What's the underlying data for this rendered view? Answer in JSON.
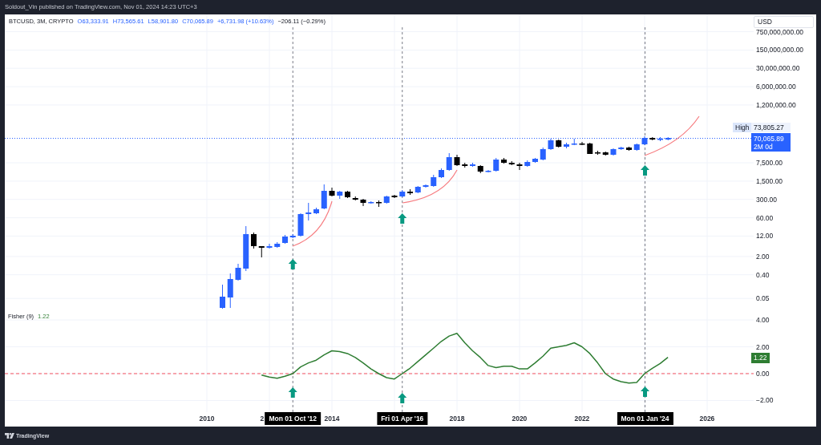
{
  "header": {
    "text": "Soldout_Vin published on TradingView.com, Nov 01, 2024 14:23 UTC+3"
  },
  "legend": {
    "symbol": "BTCUSD, 3M, CRYPTO",
    "ohlc": [
      "O63,333.91",
      "H73,565.61",
      "L58,901.80",
      "C70,065.89"
    ],
    "change": "+6,731.98 (+10.63%)",
    "last_change": "−206.11 (−0.29%)"
  },
  "price_axis": {
    "currency": "USD",
    "ticks": [
      "750,000,000.00",
      "150,000,000.00",
      "30,000,000.00",
      "6,000,000.00",
      "1,200,000.00",
      "7,500.00",
      "1,500.00",
      "300.00",
      "60.00",
      "12.00",
      "2.00",
      "0.40",
      "0.05"
    ]
  },
  "high_marker": {
    "label": "High",
    "value": "73,805.27"
  },
  "last_price": {
    "value": "70,065.89",
    "countdown": "2M 0d"
  },
  "signals": [
    {
      "date": "Mon 01 Oct '12"
    },
    {
      "date": "Fri 01 Apr '16"
    },
    {
      "date": "Mon 01 Jan '24"
    }
  ],
  "time_axis": {
    "covered_tick": "2"
  },
  "indicator": {
    "value": "1.22",
    "axis_value": "1.22",
    "chart_data": {
      "type": "line",
      "x": [
        2011.75,
        2012,
        2012.25,
        2012.5,
        2012.75,
        2013,
        2013.25,
        2013.5,
        2013.75,
        2014,
        2014.25,
        2014.5,
        2014.75,
        2015,
        2015.25,
        2015.5,
        2015.75,
        2016,
        2016.25,
        2016.5,
        2016.75,
        2017,
        2017.25,
        2017.5,
        2017.75,
        2018,
        2018.25,
        2018.5,
        2018.75,
        2019,
        2019.25,
        2019.5,
        2019.75,
        2020,
        2020.25,
        2020.5,
        2020.75,
        2021,
        2021.25,
        2021.5,
        2021.75,
        2022,
        2022.25,
        2022.5,
        2022.75,
        2023,
        2023.25,
        2023.5,
        2023.75,
        2024,
        2024.25,
        2024.5,
        2024.75
      ],
      "series": [
        {
          "name": "Fisher (9)",
          "color": "#2e7d32",
          "values": [
            -0.1,
            -0.25,
            -0.35,
            -0.2,
            0.0,
            0.5,
            0.8,
            1.0,
            1.4,
            1.7,
            1.65,
            1.5,
            1.2,
            0.8,
            0.35,
            0.0,
            -0.3,
            -0.4,
            0.0,
            0.4,
            0.9,
            1.4,
            1.9,
            2.4,
            2.8,
            3.0,
            2.3,
            1.7,
            1.2,
            0.6,
            0.45,
            0.55,
            0.55,
            0.35,
            0.35,
            0.8,
            1.3,
            1.9,
            2.0,
            2.1,
            2.3,
            2.0,
            1.5,
            0.8,
            0.0,
            -0.4,
            -0.6,
            -0.7,
            -0.65,
            0.0,
            0.4,
            0.75,
            1.22
          ]
        }
      ],
      "xlim": [
        2003.54,
        2027.49
      ],
      "ylim": [
        -2.87,
        4.84
      ],
      "xticks": [
        {
          "value": 2010,
          "label": "2010"
        },
        {
          "value": 2014,
          "label": "2014"
        },
        {
          "value": 2018,
          "label": "2018"
        },
        {
          "value": 2020,
          "label": "2020"
        },
        {
          "value": 2022,
          "label": "2022"
        },
        {
          "value": 2026,
          "label": "2026"
        }
      ],
      "yticks": [
        {
          "value": 4,
          "label": "4.00"
        },
        {
          "value": 2,
          "label": "2.00"
        },
        {
          "value": 0,
          "label": "0.00"
        },
        {
          "value": -2,
          "label": "−2.00"
        }
      ],
      "grid": true,
      "ref_lines": [
        {
          "axis": "y",
          "value": 0,
          "color": "#f7525f"
        }
      ]
    }
  },
  "footer": {
    "brand": "TradingView"
  }
}
